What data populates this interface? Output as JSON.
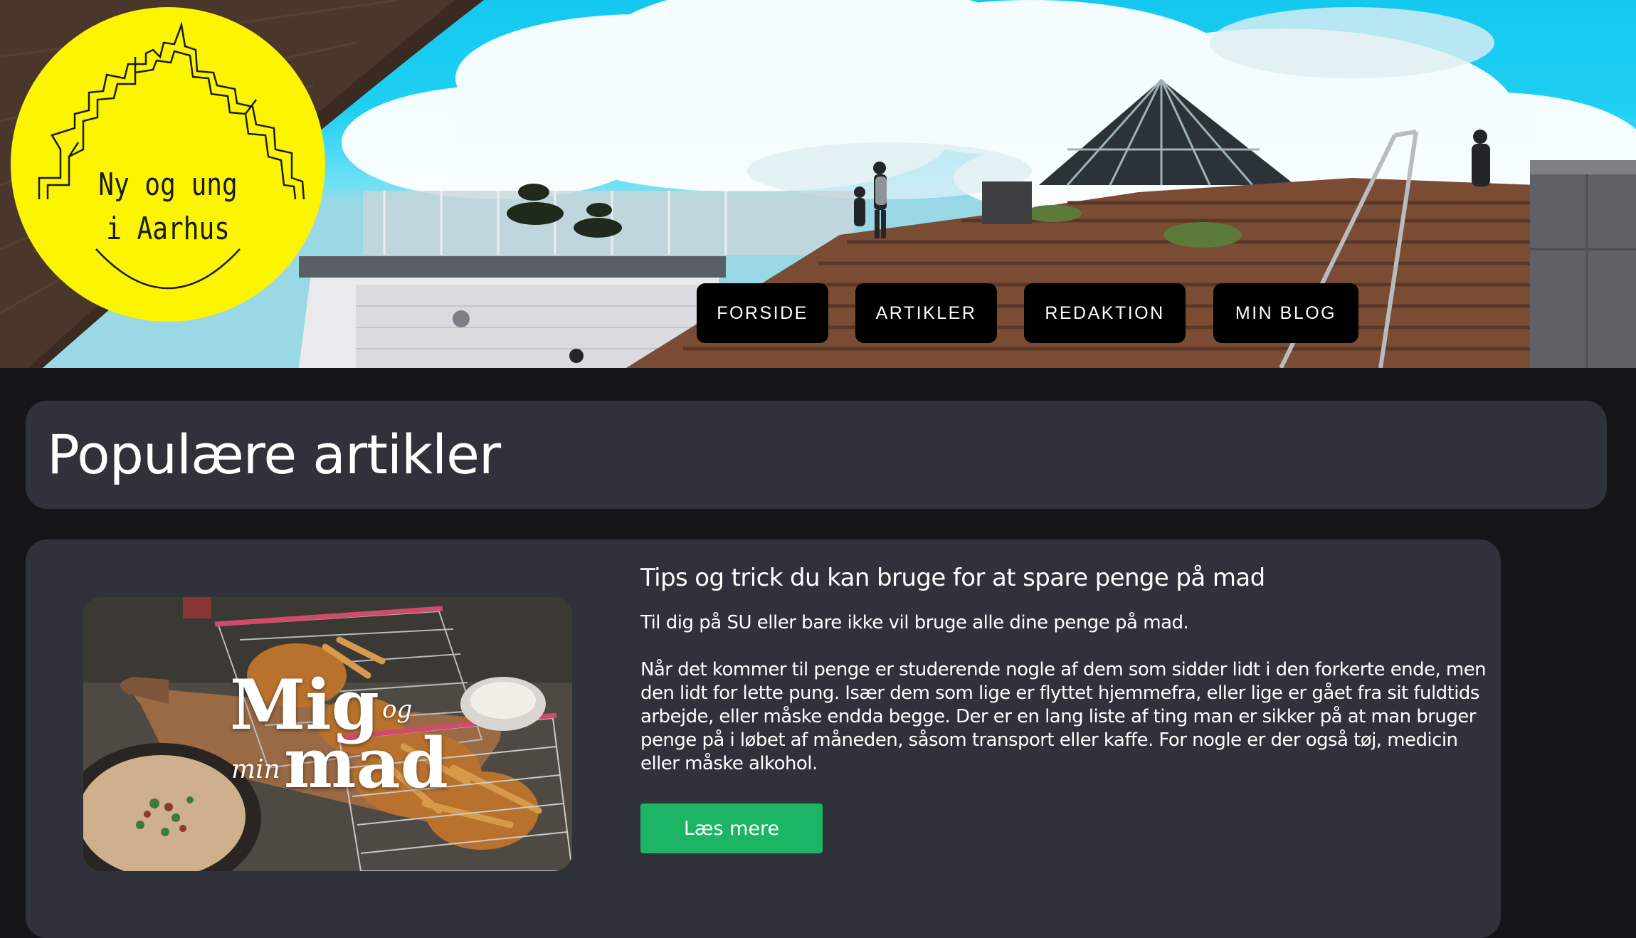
{
  "logo": {
    "line1": "Ny og ung",
    "line2": "i Aarhus"
  },
  "nav": {
    "items": [
      {
        "label": "FORSIDE"
      },
      {
        "label": "ARTIKLER"
      },
      {
        "label": "REDAKTION"
      },
      {
        "label": "MIN BLOG"
      }
    ]
  },
  "main": {
    "heading": "Populære artikler",
    "articles": [
      {
        "thumbnail": {
          "word_mig": "Mig",
          "word_og": "og",
          "word_min": "min",
          "word_mad": "mad"
        },
        "title": "Tips og trick du kan bruge for at spare penge på mad",
        "subtitle": "Til dig på SU eller bare ikke vil bruge alle dine penge på mad.",
        "body": "Når det kommer til penge er studerende nogle af dem som sidder lidt i den forkerte ende, men den lidt for lette pung. Især dem som lige er flyttet hjemmefra, eller lige er gået fra sit fuldtids arbejde, eller måske endda begge. Der er en lang liste af ting man er sikker på at man bruger penge på i løbet af måneden, såsom transport eller kaffe. For nogle er der også tøj, medicin eller måske alkohol.",
        "read_more_label": "Læs mere"
      }
    ]
  },
  "colors": {
    "page_background": "#151519",
    "panel_background": "#2f323b",
    "logo_yellow": "#fcf500",
    "nav_button": "#000000",
    "read_more_green": "#1cb465"
  }
}
